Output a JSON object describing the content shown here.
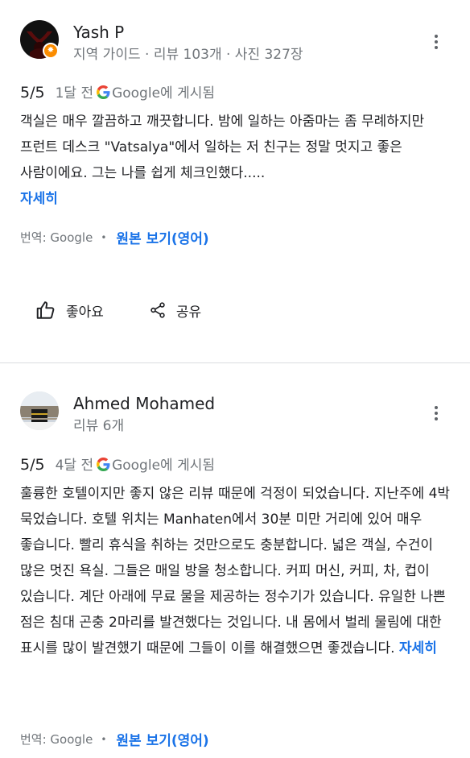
{
  "reviews": [
    {
      "author": "Yash P",
      "meta": "지역 가이드 · 리뷰 103개 · 사진 327장",
      "rating": "5/5",
      "time": "1달 전",
      "platform": "Google에 게시됨",
      "text": "객실은 매우 깔끔하고 깨끗합니다. 밤에 일하는 아줌마는 좀 무례하지만 프런트 데스크 \"Vatsalya\"에서 일하는 저 친구는 정말 멋지고 좋은 사람이에요. 그는 나를 쉽게 체크인했다.....",
      "more_label": "자세히",
      "translated_by": "번역: Google",
      "original_label": "원본 보기(영어)",
      "like_label": "좋아요",
      "share_label": "공유"
    },
    {
      "author": "Ahmed Mohamed",
      "meta": "리뷰 6개",
      "rating": "5/5",
      "time": "4달 전",
      "platform": "Google에 게시됨",
      "text": "훌륭한 호텔이지만 좋지 않은 리뷰 때문에 걱정이 되었습니다. 지난주에 4박 묵었습니다. 호텔 위치는 Manhaten에서 30분 미만 거리에 있어 매우 좋습니다. 빨리 휴식을 취하는 것만으로도 충분합니다. 넓은 객실, 수건이 많은 멋진 욕실. 그들은 매일 방을 청소합니다. 커피 머신, 커피, 차, 컵이 있습니다. 계단 아래에 무료 물을 제공하는 정수기가 있습니다. 유일한 나쁜 점은 침대 곤충 2마리를 발견했다는 것입니다. 내 몸에서 벌레 물림에 대한 표시를 많이 발견했기 때문에 그들이 이를 해결했으면 좋겠습니다.",
      "more_label": "자세히",
      "translated_by": "번역: Google",
      "original_label": "원본 보기(영어)"
    }
  ],
  "colors": {
    "link": "#1a73e8",
    "secondary_text": "#70757a",
    "guide_badge": "#fb8c00"
  },
  "icons": [
    "more-vert-icon",
    "google-g-icon",
    "thumb-up-icon",
    "share-icon",
    "local-guide-badge-icon"
  ]
}
